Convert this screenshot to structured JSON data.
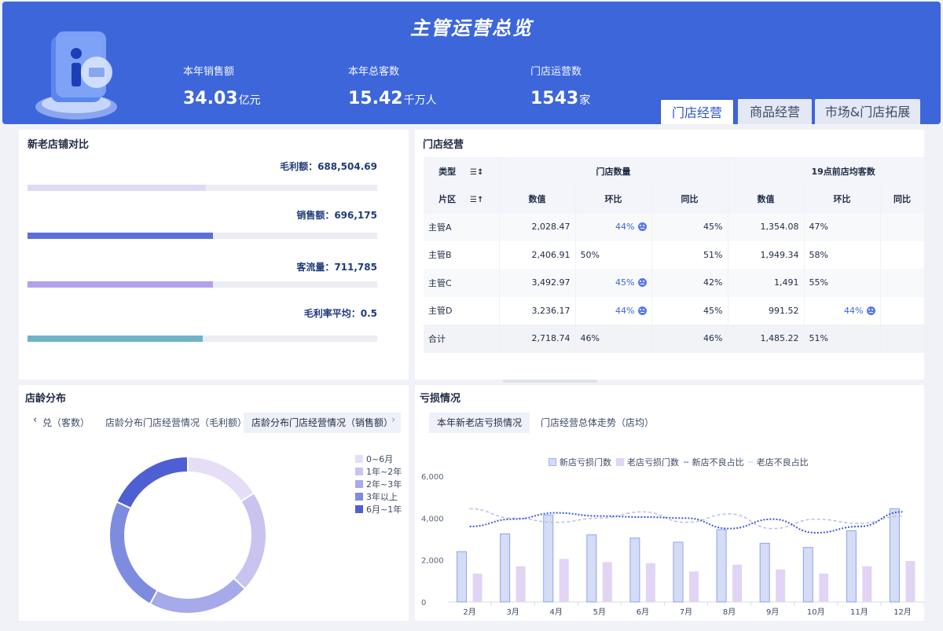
{
  "header": {
    "title": "主管运营总览",
    "kpis": [
      {
        "label": "本年销售额",
        "value": "34.03",
        "unit": "亿元"
      },
      {
        "label": "本年总客数",
        "value": "15.42",
        "unit": "千万人"
      },
      {
        "label": "门店运营数",
        "value": "1543",
        "unit": "家"
      }
    ],
    "tabs": [
      "门店经营",
      "商品经营",
      "市场&门店拓展"
    ],
    "active_tab": "门店经营"
  },
  "compare": {
    "title": "新老店铺对比",
    "bars": [
      {
        "label": "毛利额：688,504.69",
        "fraction": 0.51,
        "color": "#dcdaf6"
      },
      {
        "label": "销售额：696,175",
        "fraction": 0.53,
        "color": "#5b6fdc"
      },
      {
        "label": "客流量：711,785",
        "fraction": 0.53,
        "color": "#b4a0ec"
      },
      {
        "label": "毛利率平均：0.5",
        "fraction": 0.5,
        "color": "#6fb3c8"
      }
    ]
  },
  "store_ops": {
    "title": "门店经营",
    "head1": {
      "type": "类型",
      "group1": "门店数量",
      "group2": "19点前店均客数"
    },
    "head2": {
      "area": "片区",
      "cols": [
        "数值",
        "环比",
        "同比",
        "数值",
        "环比",
        "同比"
      ]
    },
    "rows": [
      {
        "name": "主管A",
        "cells": [
          "2,028.47",
          "44%",
          "45%",
          "1,354.08",
          "47%",
          ""
        ],
        "flags": [
          false,
          true,
          false,
          false,
          false,
          false
        ]
      },
      {
        "name": "主管B",
        "cells": [
          "2,406.91",
          "50%",
          "51%",
          "1,949.34",
          "58%",
          ""
        ],
        "flags": [
          false,
          false,
          false,
          false,
          false,
          false
        ]
      },
      {
        "name": "主管C",
        "cells": [
          "3,492.97",
          "45%",
          "42%",
          "1,491",
          "55%",
          ""
        ],
        "flags": [
          false,
          true,
          false,
          false,
          false,
          false
        ]
      },
      {
        "name": "主管D",
        "cells": [
          "3,236.17",
          "44%",
          "45%",
          "991.52",
          "44%",
          ""
        ],
        "flags": [
          false,
          true,
          false,
          false,
          true,
          false
        ]
      },
      {
        "name": "合计",
        "cells": [
          "2,718.74",
          "46%",
          "46%",
          "1,485.22",
          "51%",
          ""
        ],
        "flags": [
          false,
          false,
          false,
          false,
          false,
          false
        ]
      }
    ]
  },
  "store_age": {
    "title": "店龄分布",
    "subtabs": [
      "兑（客数）",
      "店龄分布门店经营情况（毛利额）",
      "店龄分布门店经营情况（销售额）"
    ],
    "active_subtab": "店龄分布门店经营情况（销售额）",
    "legend": [
      {
        "label": "0~6月",
        "color": "#e6def6"
      },
      {
        "label": "1年~2年",
        "color": "#c8c3ef"
      },
      {
        "label": "2年~3年",
        "color": "#a6a9ea"
      },
      {
        "label": "3年以上",
        "color": "#7e8ce0"
      },
      {
        "label": "6月~1年",
        "color": "#4e5fd3"
      }
    ]
  },
  "loss": {
    "title": "亏损情况",
    "subtabs": [
      "本年新老店亏损情况",
      "门店经营总体走势（店均）"
    ],
    "active_subtab": "本年新老店亏损情况",
    "legend": [
      "新店亏损门数",
      "老店亏损门数",
      "新店不良占比",
      "老店不良占比"
    ]
  },
  "colors": {
    "accent": "#3d66db",
    "new_bar": "#d4dcf6",
    "old_bar": "#e1d4f5",
    "new_line": "#3a5bd6",
    "old_line": "#b8bfe0"
  },
  "chart_data": [
    {
      "type": "pie",
      "title": "",
      "categories": [
        "0~6月",
        "1年~2年",
        "2年~3年",
        "3年以上",
        "6月~1年"
      ],
      "values": [
        16,
        21,
        21,
        24,
        18
      ],
      "donut": true
    },
    {
      "type": "bar",
      "title": "",
      "categories": [
        "2月",
        "3月",
        "4月",
        "5月",
        "6月",
        "7月",
        "8月",
        "9月",
        "10月",
        "11月",
        "12月"
      ],
      "ylim": [
        0,
        6000
      ],
      "yticks": [
        "0",
        "2,000",
        "4,000",
        "6,000"
      ],
      "series": [
        {
          "name": "新店亏损门数",
          "type": "bar",
          "values": [
            2400,
            3250,
            4150,
            3200,
            3050,
            2850,
            3450,
            2800,
            2600,
            3400,
            4450
          ]
        },
        {
          "name": "老店亏损门数",
          "type": "bar",
          "values": [
            1350,
            1700,
            2050,
            1900,
            1850,
            1450,
            1780,
            1550,
            1350,
            1700,
            1950
          ]
        },
        {
          "name": "新店不良占比",
          "type": "line",
          "values": [
            3600,
            3950,
            4250,
            4100,
            4050,
            4000,
            3500,
            3950,
            3300,
            3600,
            4300
          ]
        },
        {
          "name": "老店不良占比",
          "type": "line",
          "values": [
            4450,
            4000,
            3800,
            4000,
            4300,
            3800,
            4200,
            3500,
            3950,
            3750,
            4100
          ]
        }
      ]
    }
  ]
}
